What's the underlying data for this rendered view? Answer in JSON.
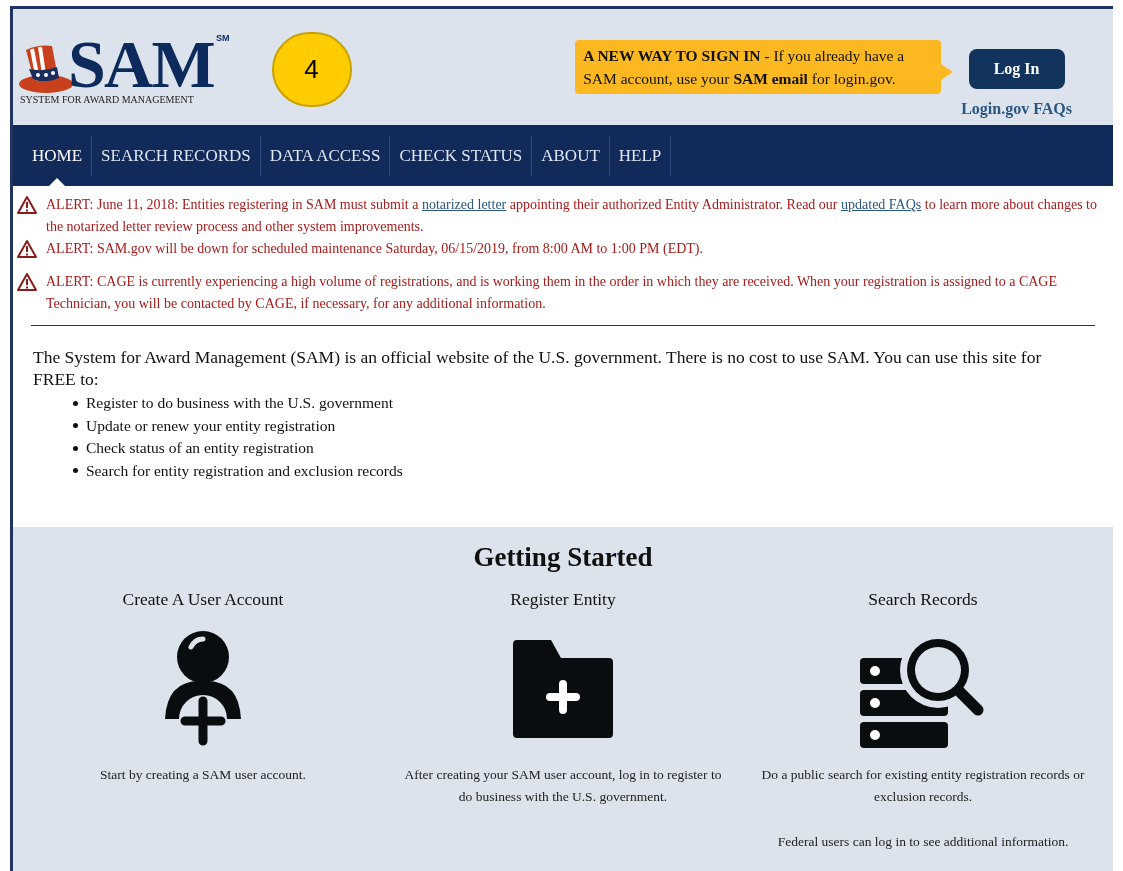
{
  "logo": {
    "title": "SAM",
    "mark": "SM",
    "subtitle": "SYSTEM FOR AWARD MANAGEMENT"
  },
  "step_badge": "4",
  "sign_in_callout": "**A NEW WAY TO SIGN IN** - If you already have a SAM account, use your **SAM email** for login.gov.",
  "login_button": "Log In",
  "faq_link": "Login.gov FAQs",
  "nav": [
    {
      "label": "HOME",
      "selected": true
    },
    {
      "label": "SEARCH RECORDS",
      "selected": false
    },
    {
      "label": "DATA ACCESS",
      "selected": false
    },
    {
      "label": "CHECK STATUS",
      "selected": false
    },
    {
      "label": "ABOUT",
      "selected": false
    },
    {
      "label": "HELP",
      "selected": false
    }
  ],
  "alerts": [
    {
      "parts": [
        {
          "kind": "text",
          "text": "ALERT: June 11, 2018: Entities registering in SAM must submit a "
        },
        {
          "kind": "link",
          "text": "notarized letter"
        },
        {
          "kind": "text",
          "text": " appointing their authorized Entity Administrator. Read our "
        },
        {
          "kind": "link",
          "text": "updated FAQs"
        },
        {
          "kind": "text",
          "text": " to learn more about changes to the notarized letter review process and other system improvements."
        }
      ]
    },
    {
      "parts": [
        {
          "kind": "text",
          "text": "ALERT: SAM.gov will be down for scheduled maintenance Saturday, 06/15/2019, from 8:00 AM to 1:00 PM (EDT)."
        }
      ]
    },
    {
      "parts": [
        {
          "kind": "text",
          "text": "ALERT: CAGE is currently experiencing a high volume of registrations, and is working them in the order in which they are received. When your registration is assigned to a CAGE Technician, you will be contacted by CAGE, if necessary, for any additional information."
        }
      ]
    }
  ],
  "intro": {
    "text": "The System for Award Management (SAM) is an official website of the U.S. government. There is no cost to use SAM. You can use this site for FREE to:",
    "bullets": [
      "Register to do business with the U.S. government",
      "Update or renew your entity registration",
      "Check status of an entity registration",
      "Search for entity registration and exclusion records"
    ]
  },
  "getting_started": {
    "title": "Getting Started",
    "cards": [
      {
        "kind": "user",
        "title": "Create A User Account",
        "texts": [
          "Start by creating a SAM user account."
        ]
      },
      {
        "kind": "folder",
        "title": "Register Entity",
        "texts": [
          "After creating your SAM user account, log in to register to do business with the U.S. government."
        ]
      },
      {
        "kind": "search",
        "title": "Search Records",
        "texts": [
          "Do a public search for existing entity registration records or exclusion records.",
          "Federal users can log in to see additional information."
        ]
      }
    ]
  }
}
